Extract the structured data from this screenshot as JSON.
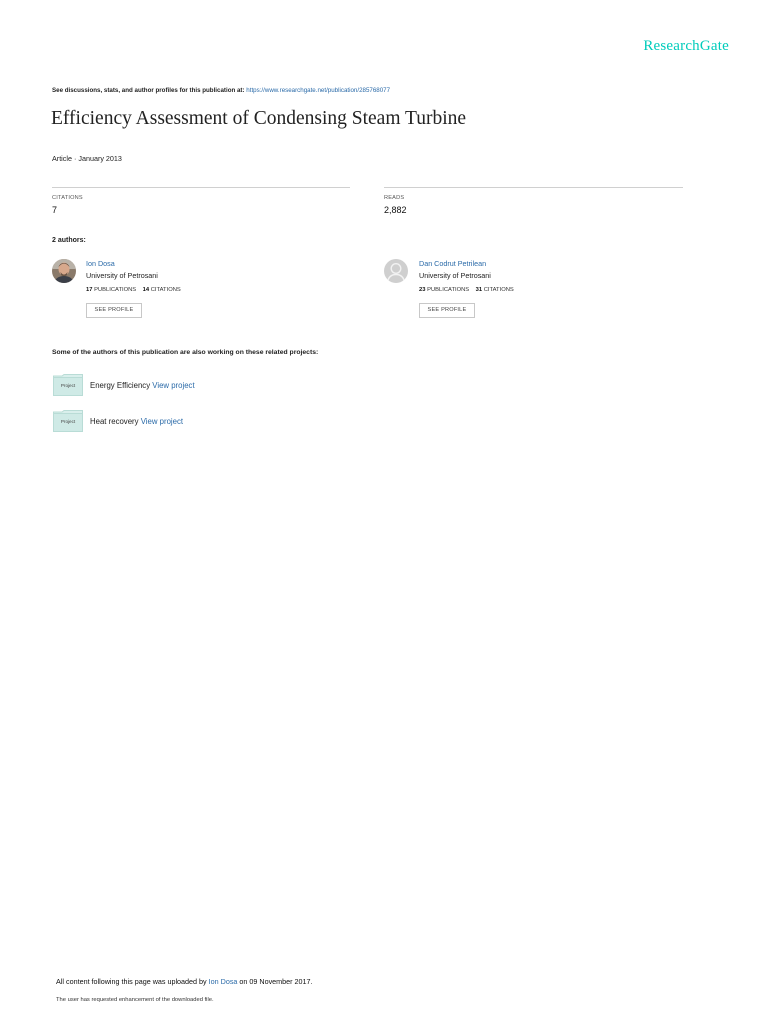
{
  "brand": {
    "logo_text": "ResearchGate"
  },
  "intro": {
    "prefix": "See discussions, stats, and author profiles for this publication at:",
    "url": "https://www.researchgate.net/publication/285768077"
  },
  "article": {
    "title": "Efficiency Assessment of Condensing Steam Turbine",
    "meta": "Article · January 2013"
  },
  "stats": {
    "citations_label": "CITATIONS",
    "citations_value": "7",
    "reads_label": "READS",
    "reads_value": "2,882"
  },
  "authors_heading": "2 authors:",
  "authors": [
    {
      "name": "Ion Dosa",
      "affiliation": "University of Petrosani",
      "publications_count": "17",
      "publications_label": "PUBLICATIONS",
      "citations_count": "14",
      "citations_label": "CITATIONS",
      "button_label": "SEE PROFILE",
      "avatar_icon": "author-photo"
    },
    {
      "name": "Dan Codrut Petrilean",
      "affiliation": "University of Petrosani",
      "publications_count": "23",
      "publications_label": "PUBLICATIONS",
      "citations_count": "31",
      "citations_label": "CITATIONS",
      "button_label": "SEE PROFILE",
      "avatar_icon": "default-avatar-icon"
    }
  ],
  "projects_heading": "Some of the authors of this publication are also working on these related projects:",
  "projects": [
    {
      "folder_label": "Project",
      "name": "Energy Efficiency",
      "link_label": "View project"
    },
    {
      "folder_label": "Project",
      "name": "Heat recovery",
      "link_label": "View project"
    }
  ],
  "footer": {
    "prefix": "All content following this page was uploaded by",
    "uploader": "Ion Dosa",
    "suffix": "on 09 November 2017.",
    "note": "The user has requested enhancement of the downloaded file."
  },
  "colors": {
    "brand": "#00ccbb",
    "link": "#2a6aa8",
    "folder": "#cfeae6"
  }
}
